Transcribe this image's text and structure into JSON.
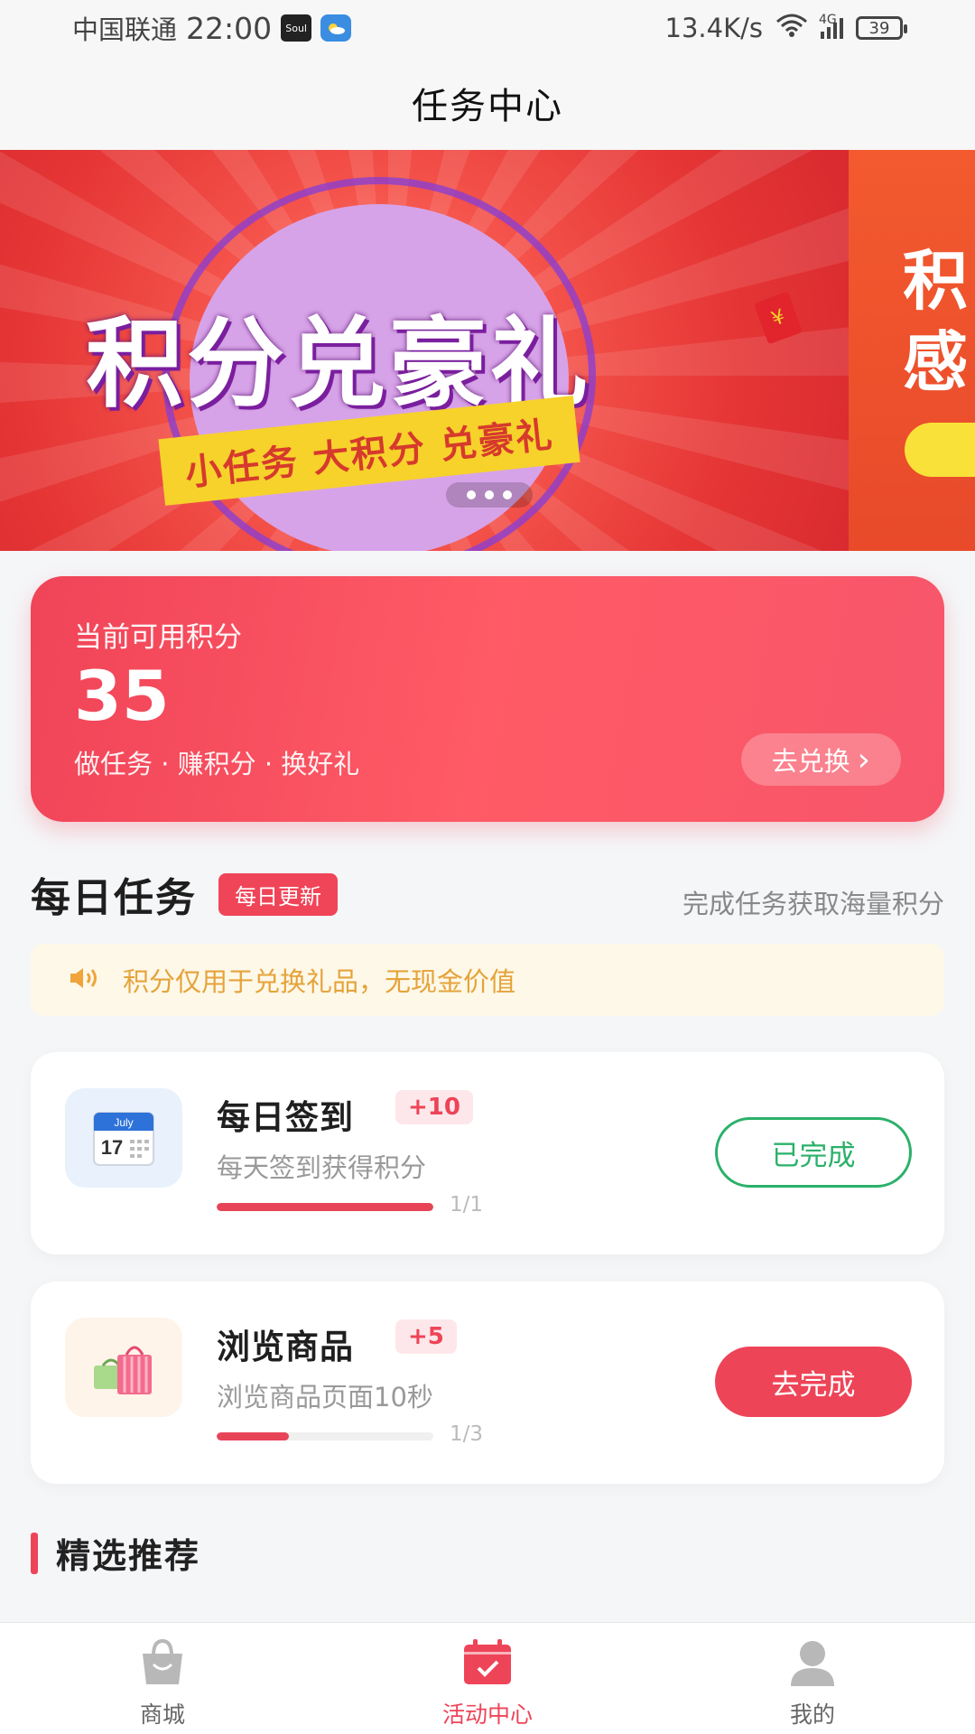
{
  "status_bar": {
    "carrier": "中国联通",
    "time": "22:00",
    "app_badge_1": "Soul",
    "network_speed": "13.4K/s",
    "network_type": "4G",
    "battery": "39"
  },
  "header": {
    "title": "任务中心"
  },
  "banner": {
    "headline": "积分兑豪礼",
    "ribbon": "小任务 大积分 兑豪礼",
    "envelope_symbol": "¥",
    "next_slide_text": "积\n感",
    "slide_count": 3
  },
  "points_card": {
    "label": "当前可用积分",
    "value": "35",
    "tagline": "做任务 · 赚积分 · 换好礼",
    "redeem_button": "去兑换",
    "redeem_arrow": "›"
  },
  "daily_tasks": {
    "title": "每日任务",
    "badge": "每日更新",
    "subtitle": "完成任务获取海量积分",
    "notice": "积分仅用于兑换礼品，无现金价值"
  },
  "tasks": [
    {
      "title": "每日签到",
      "points": "+10",
      "desc": "每天签到获得积分",
      "progress": 1.0,
      "progress_text": "1/1",
      "button": "已完成",
      "icon": "calendar-icon",
      "icon_month": "July",
      "icon_day": "17"
    },
    {
      "title": "浏览商品",
      "points": "+5",
      "desc": "浏览商品页面10秒",
      "progress": 0.3333,
      "progress_text": "1/3",
      "button": "去完成",
      "icon": "shopping-bag-icon"
    }
  ],
  "featured": {
    "title": "精选推荐"
  },
  "tab_bar": {
    "items": [
      {
        "label": "商城",
        "icon": "shop-bag-icon",
        "active": false
      },
      {
        "label": "活动中心",
        "icon": "calendar-check-icon",
        "active": true
      },
      {
        "label": "我的",
        "icon": "user-icon",
        "active": false
      }
    ]
  },
  "colors": {
    "accent": "#ee4458",
    "success": "#2bb06a",
    "notice_text": "#e5a33b"
  }
}
